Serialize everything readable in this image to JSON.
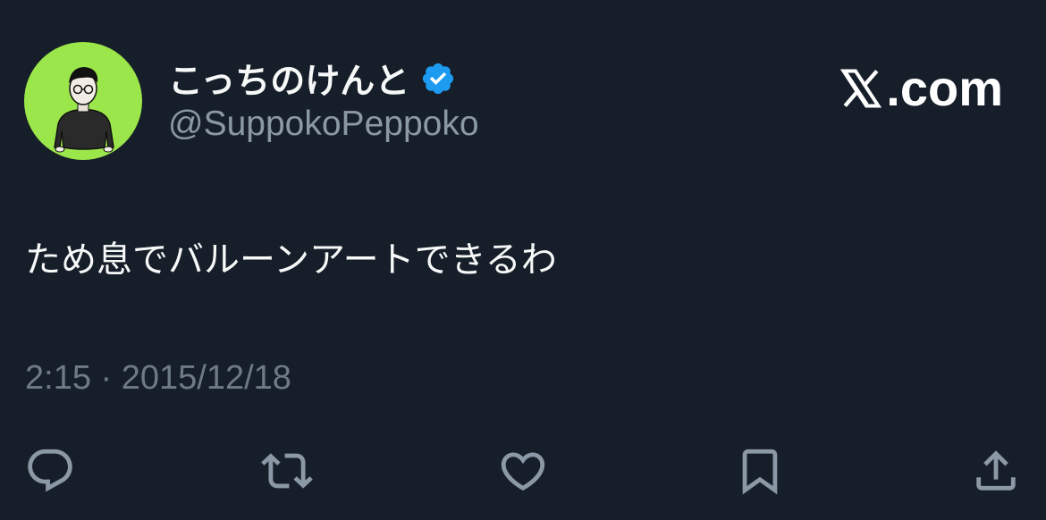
{
  "author": {
    "display_name": "こっちのけんと",
    "handle": "@SuppokoPeppoko",
    "verified": true,
    "avatar_bg": "#9be64a"
  },
  "brand": {
    "logo_text": ".com",
    "logo_icon": "x-logo-icon"
  },
  "tweet": {
    "text": "ため息でバルーンアートできるわ",
    "timestamp": "2:15 · 2015/12/18"
  },
  "actions": [
    {
      "icon": "reply-icon"
    },
    {
      "icon": "retweet-icon"
    },
    {
      "icon": "like-icon"
    },
    {
      "icon": "bookmark-icon"
    },
    {
      "icon": "share-icon"
    }
  ],
  "colors": {
    "background": "#161e29",
    "text_primary": "#f7f9f9",
    "text_secondary": "#8b98a5",
    "icon": "#8b98a5",
    "verified": "#1d9bf0"
  }
}
